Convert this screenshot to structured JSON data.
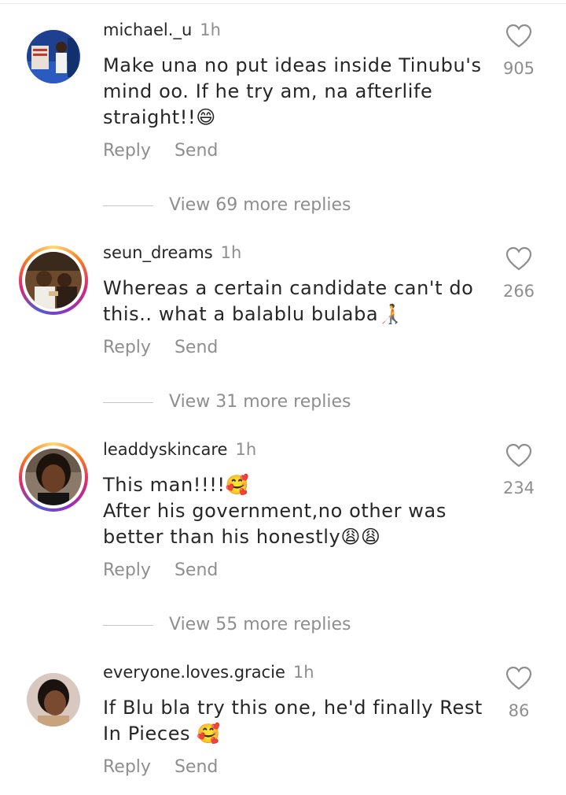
{
  "colors": {
    "text": "#262626",
    "muted": "#8e8e8e",
    "story_ring": "#d62976"
  },
  "comments": [
    {
      "username": "michael._u",
      "time": "1h",
      "text": "Make una no put ideas inside Tinubu's mind oo. If he try am, na afterlife straight!!😄",
      "likes": "905",
      "reply_label": "Reply",
      "send_label": "Send",
      "view_replies": "View 69 more replies",
      "has_story_ring": false
    },
    {
      "username": "seun_dreams",
      "time": "1h",
      "text": "Whereas a certain candidate can't do this.. what a balablu bulaba🧑‍🦯",
      "likes": "266",
      "reply_label": "Reply",
      "send_label": "Send",
      "view_replies": "View 31 more replies",
      "has_story_ring": true
    },
    {
      "username": "leaddyskincare",
      "time": "1h",
      "text_line1": "This man!!!!🥰",
      "text_line2": "After his government,no other was better than his honestly😩😩",
      "likes": "234",
      "reply_label": "Reply",
      "send_label": "Send",
      "view_replies": "View 55 more replies",
      "has_story_ring": true
    },
    {
      "username": "everyone.loves.gracie",
      "time": "1h",
      "text": "If Blu bla try this one, he'd finally Rest In Pieces 🥰",
      "likes": "86",
      "reply_label": "Reply",
      "send_label": "Send",
      "has_story_ring": false
    }
  ]
}
